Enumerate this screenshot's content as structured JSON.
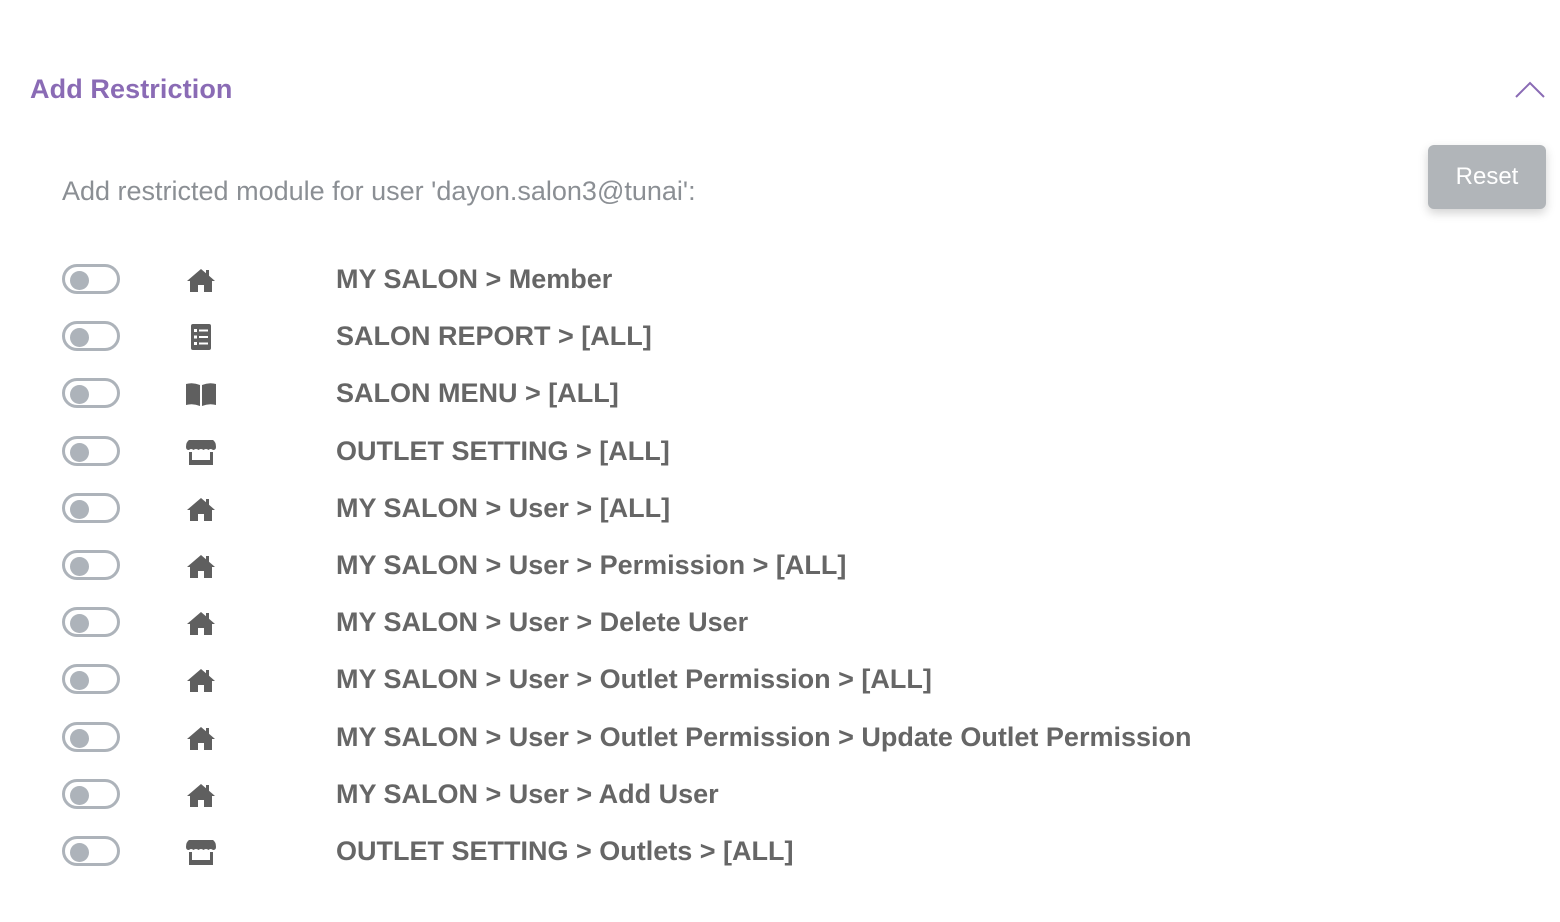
{
  "section": {
    "title": "Add Restriction",
    "collapse_icon": "chevron-up-icon",
    "accent_color": "#8a6bb5"
  },
  "actions": {
    "reset_label": "Reset"
  },
  "subtitle": "Add restricted module for user 'dayon.salon3@tunai':",
  "restrictions": [
    {
      "icon": "home-icon",
      "label": "MY SALON > Member",
      "enabled": false
    },
    {
      "icon": "list-icon",
      "label": "SALON REPORT > [ALL]",
      "enabled": false
    },
    {
      "icon": "book-icon",
      "label": "SALON MENU > [ALL]",
      "enabled": false
    },
    {
      "icon": "store-icon",
      "label": "OUTLET SETTING > [ALL]",
      "enabled": false
    },
    {
      "icon": "home-icon",
      "label": "MY SALON > User > [ALL]",
      "enabled": false
    },
    {
      "icon": "home-icon",
      "label": "MY SALON > User > Permission > [ALL]",
      "enabled": false
    },
    {
      "icon": "home-icon",
      "label": "MY SALON > User > Delete User",
      "enabled": false
    },
    {
      "icon": "home-icon",
      "label": "MY SALON > User > Outlet Permission > [ALL]",
      "enabled": false
    },
    {
      "icon": "home-icon",
      "label": "MY SALON > User > Outlet Permission > Update Outlet Permission",
      "enabled": false
    },
    {
      "icon": "home-icon",
      "label": "MY SALON > User > Add User",
      "enabled": false
    },
    {
      "icon": "store-icon",
      "label": "OUTLET SETTING > Outlets > [ALL]",
      "enabled": false
    }
  ]
}
